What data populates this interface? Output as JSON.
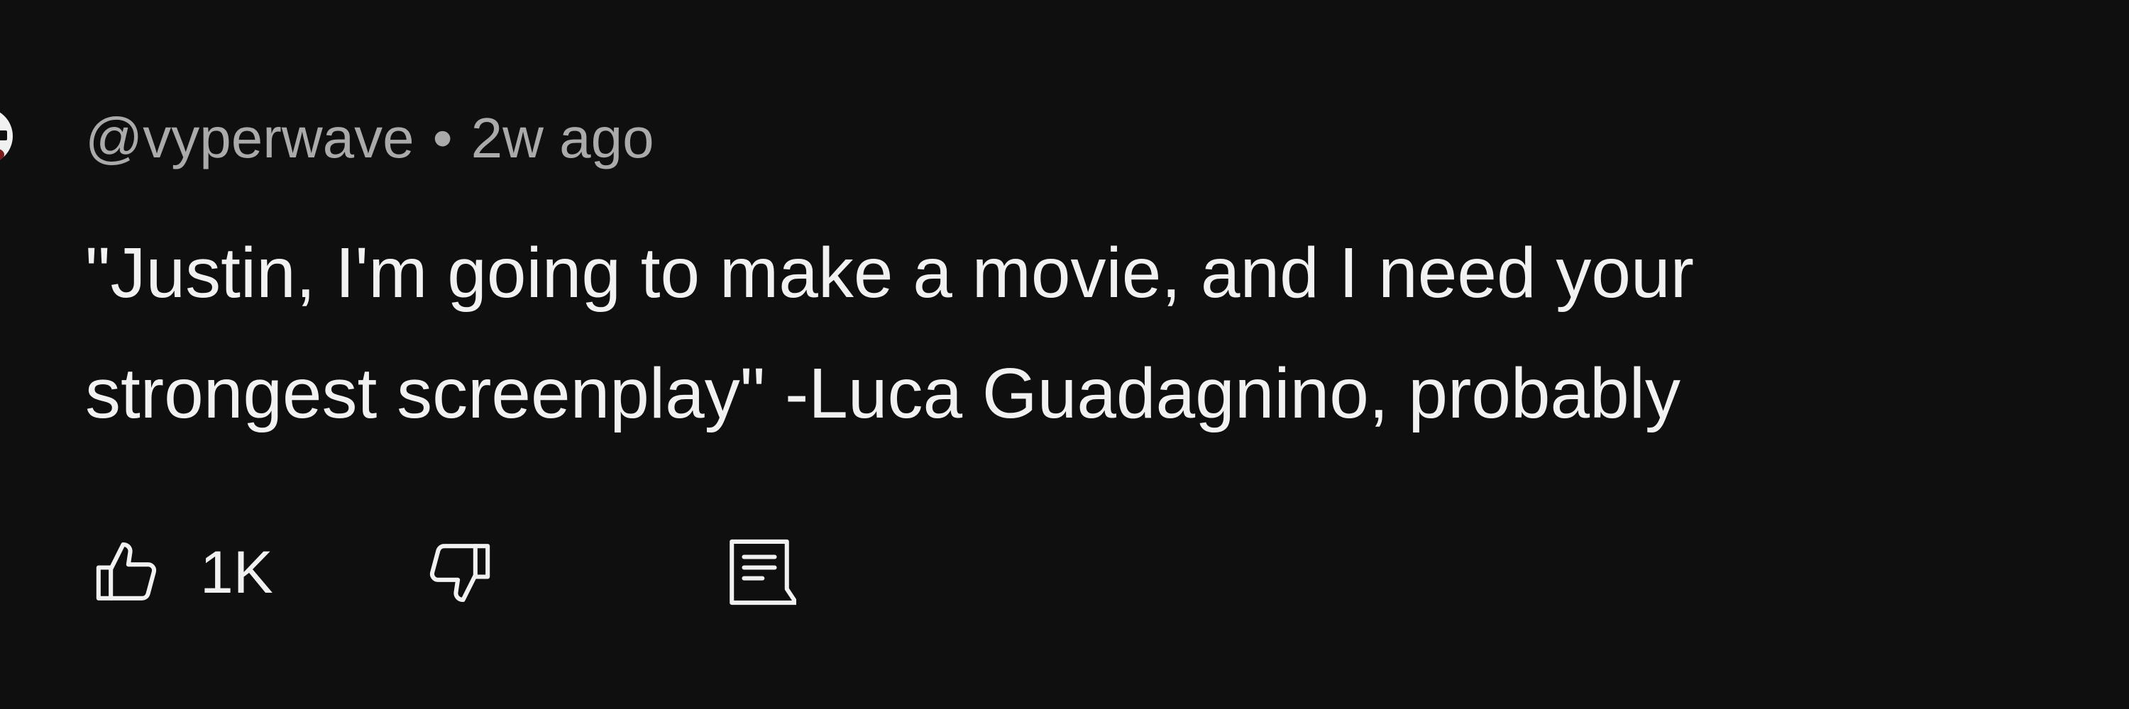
{
  "comment": {
    "author": "@vyperwave",
    "separator": "•",
    "timestamp": "2w ago",
    "text_lines": [
      "\"Justin, I'm going to make a movie, and I need your",
      "strongest screenplay\" -Luca Guadagnino, probably"
    ]
  },
  "actions": {
    "like_icon": "thumbs-up-icon",
    "like_count": "1K",
    "dislike_icon": "thumbs-down-icon",
    "reply_icon": "reply-comment-icon"
  },
  "colors": {
    "background": "#0f0f0f",
    "meta_text": "#aaaaaa",
    "body_text": "#f1f1f1",
    "icon": "#f1f1f1"
  }
}
